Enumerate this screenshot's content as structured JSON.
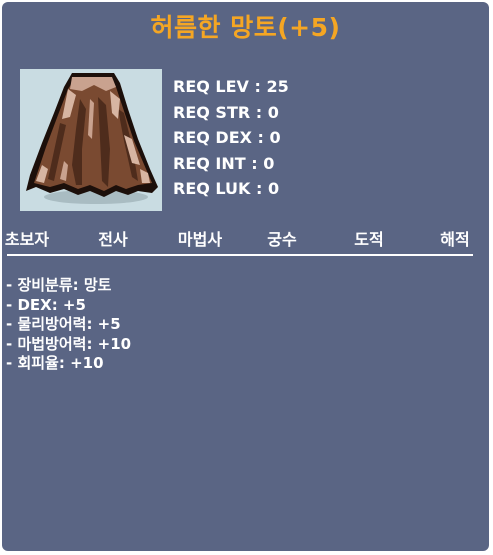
{
  "item": {
    "name": "허름한 망토(+5)",
    "icon": "brown-cape-icon",
    "name_color": "#f5a623",
    "panel_color": "#5a6584"
  },
  "requirements": [
    {
      "label": "REQ LEV",
      "value": "25"
    },
    {
      "label": "REQ STR",
      "value": "0"
    },
    {
      "label": "REQ DEX",
      "value": "0"
    },
    {
      "label": "REQ INT",
      "value": "0"
    },
    {
      "label": "REQ LUK",
      "value": "0"
    }
  ],
  "jobs": [
    "초보자",
    "전사",
    "마법사",
    "궁수",
    "도적",
    "해적"
  ],
  "stats": [
    "- 장비분류: 망토",
    "- DEX: +5",
    "- 물리방어력: +5",
    "- 마법방어력: +10",
    "- 회피율: +10"
  ]
}
